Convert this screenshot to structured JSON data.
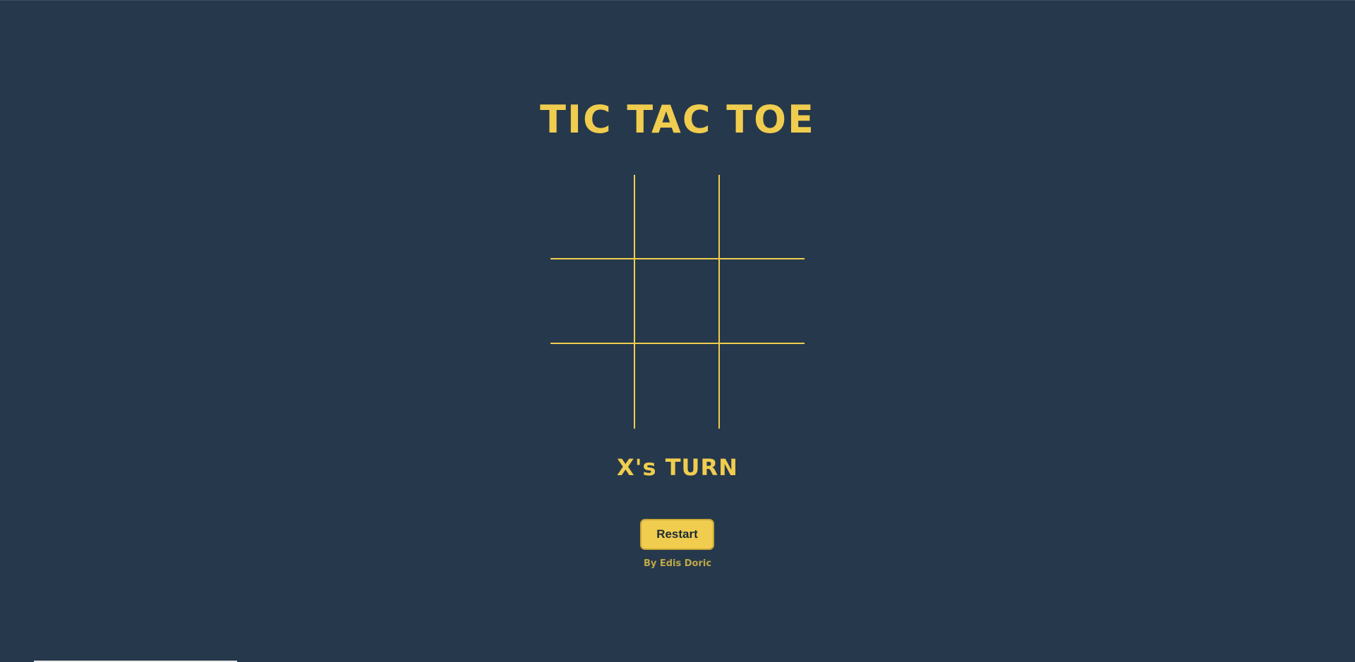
{
  "game": {
    "title": "TIC TAC TOE",
    "cells": [
      "",
      "",
      "",
      "",
      "",
      "",
      "",
      "",
      ""
    ],
    "status": "X's TURN",
    "restart_label": "Restart",
    "credit": "By Edis Doric"
  },
  "colors": {
    "background": "#26384b",
    "accent": "#f0cd4f",
    "button_text": "#1e2a36"
  }
}
